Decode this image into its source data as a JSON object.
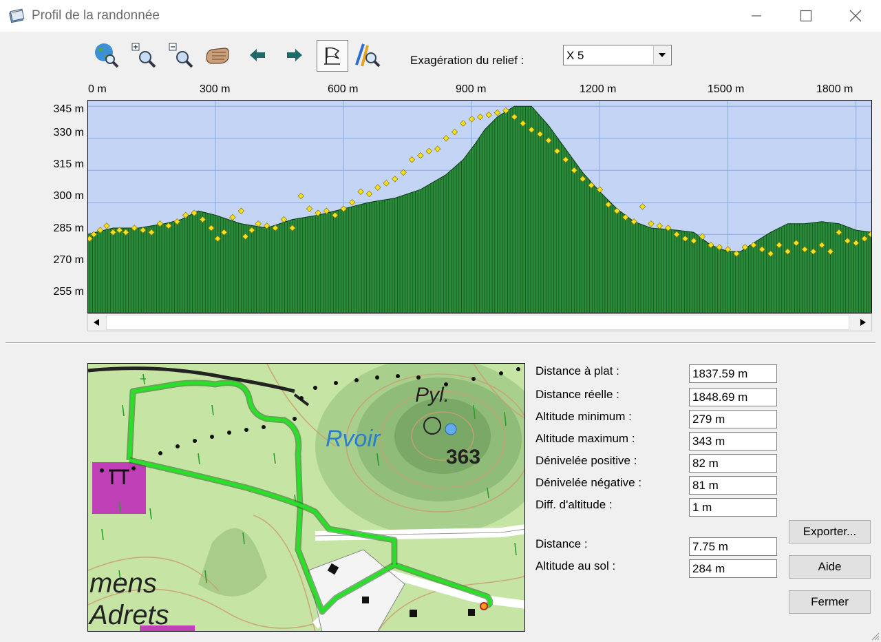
{
  "window": {
    "title": "Profil de la randonnée",
    "icon": "notebook-icon",
    "controls": [
      "minimize-icon",
      "maximize-icon",
      "close-icon"
    ]
  },
  "toolbar": {
    "icons": [
      "globe-search-icon",
      "zoom-in-icon",
      "zoom-out-icon",
      "pan-hand-icon",
      "arrow-left-icon",
      "arrow-right-icon",
      "flag-icon",
      "route-search-icon"
    ],
    "exaggeration_label": "Exagération du relief :",
    "exaggeration_value": "X 5"
  },
  "chart_data": {
    "type": "area",
    "x_ticks": [
      "0 m",
      "300 m",
      "600 m",
      "900 m",
      "1200 m",
      "1500 m",
      "1800 m"
    ],
    "y_ticks": [
      "345 m",
      "330 m",
      "315 m",
      "300 m",
      "285 m",
      "270 m",
      "255 m"
    ],
    "xlim": [
      0,
      1837.59
    ],
    "ylim": [
      248,
      348
    ],
    "grid": true,
    "colors": {
      "sky": "#c4d4f4",
      "terrain": "#2a8a3a",
      "gps_points": "#f4e020",
      "grid": "#8aaae6"
    },
    "terrain_profile": {
      "x": [
        0,
        60,
        120,
        180,
        220,
        260,
        300,
        360,
        420,
        480,
        540,
        600,
        660,
        720,
        780,
        840,
        880,
        910,
        930,
        960,
        1000,
        1040,
        1080,
        1120,
        1160,
        1200,
        1240,
        1280,
        1320,
        1380,
        1420,
        1460,
        1500,
        1530,
        1560,
        1600,
        1640,
        1680,
        1720,
        1760,
        1800,
        1837.59
      ],
      "y": [
        285,
        288,
        288,
        290,
        292,
        296,
        294,
        290,
        288,
        292,
        294,
        297,
        300,
        302,
        306,
        313,
        320,
        328,
        334,
        340,
        345,
        345,
        336,
        325,
        314,
        305,
        297,
        291,
        288,
        287,
        286,
        280,
        277,
        277,
        281,
        286,
        290,
        290,
        291,
        290,
        287,
        286
      ]
    },
    "gps_points": {
      "x": [
        5,
        15,
        30,
        45,
        60,
        75,
        90,
        110,
        130,
        150,
        170,
        190,
        210,
        230,
        250,
        270,
        290,
        305,
        320,
        340,
        360,
        370,
        385,
        400,
        420,
        440,
        460,
        480,
        500,
        520,
        540,
        560,
        580,
        600,
        620,
        640,
        660,
        680,
        700,
        720,
        740,
        760,
        780,
        800,
        820,
        840,
        860,
        880,
        900,
        920,
        940,
        960,
        980,
        1000,
        1020,
        1040,
        1060,
        1080,
        1100,
        1120,
        1140,
        1160,
        1180,
        1200,
        1220,
        1240,
        1260,
        1280,
        1300,
        1320,
        1340,
        1360,
        1380,
        1400,
        1420,
        1440,
        1460,
        1480,
        1500,
        1520,
        1540,
        1560,
        1580,
        1600,
        1620,
        1640,
        1660,
        1680,
        1700,
        1720,
        1740,
        1760,
        1780,
        1800,
        1820,
        1835
      ],
      "y": [
        283,
        285,
        287,
        289,
        286,
        287,
        286,
        288,
        287,
        286,
        290,
        289,
        291,
        294,
        295,
        292,
        288,
        283,
        286,
        293,
        296,
        284,
        287,
        290,
        289,
        288,
        292,
        288,
        303,
        297,
        295,
        296,
        294,
        297,
        300,
        305,
        304,
        307,
        309,
        311,
        314,
        320,
        322,
        324,
        325,
        330,
        333,
        337,
        339,
        340,
        341,
        342,
        343,
        340,
        337,
        334,
        332,
        329,
        324,
        320,
        315,
        311,
        308,
        306,
        299,
        296,
        293,
        291,
        298,
        290,
        289,
        288,
        285,
        283,
        282,
        284,
        280,
        279,
        278,
        276,
        279,
        280,
        278,
        276,
        280,
        277,
        281,
        278,
        277,
        280,
        277,
        286,
        282,
        281,
        283,
        285
      ]
    }
  },
  "stats": [
    {
      "label": "Distance à plat :",
      "value": "1837.59 m"
    },
    {
      "label": "Distance réelle :",
      "value": "1848.69 m"
    },
    {
      "label": "Altitude minimum :",
      "value": "279 m"
    },
    {
      "label": "Altitude maximum :",
      "value": "343 m"
    },
    {
      "label": "Dénivelée positive :",
      "value": "82 m"
    },
    {
      "label": "Dénivelée négative :",
      "value": "81 m"
    },
    {
      "label": "Diff. d'altitude :",
      "value": "1 m"
    },
    {
      "label": "Distance :",
      "value": "7.75 m"
    },
    {
      "label": "Altitude au sol :",
      "value": "284 m"
    }
  ],
  "buttons": {
    "export": "Exporter...",
    "help": "Aide",
    "close": "Fermer"
  },
  "map": {
    "labels": {
      "pyl": "Pyl.",
      "rvoir": "Rvoir",
      "summit": "363",
      "village_1": "mens",
      "village_2": "Adrets"
    }
  }
}
